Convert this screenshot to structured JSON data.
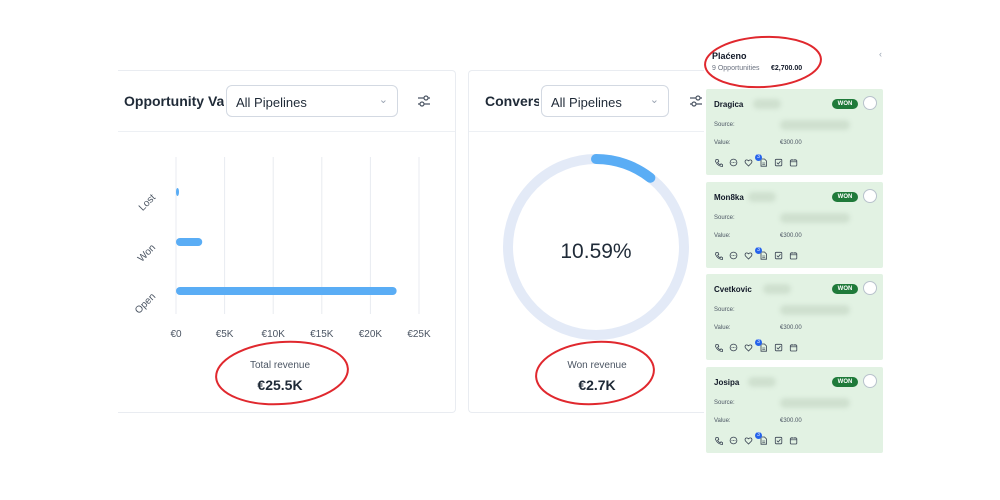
{
  "opportunity_panel": {
    "title": "Opportunity Va",
    "pipeline_select": "All Pipelines",
    "total_revenue_label": "Total revenue",
    "total_revenue_value": "€25.5K"
  },
  "chart_data": {
    "type": "bar",
    "orientation": "horizontal",
    "categories": [
      "Lost",
      "Won",
      "Open"
    ],
    "values": [
      80,
      2700,
      22700
    ],
    "x_tick_labels": [
      "€0",
      "€5K",
      "€10K",
      "€15K",
      "€20K",
      "€25K"
    ],
    "xlim": [
      0,
      25000
    ],
    "grid": true,
    "bar_color": "#5aadf5"
  },
  "conversion_panel": {
    "title": "Convers",
    "pipeline_select": "All Pipelines",
    "conversion_rate": "10.59%",
    "conversion_fraction": 0.1059,
    "won_revenue_label": "Won revenue",
    "won_revenue_value": "€2.7K",
    "ring_track_color": "#e3eaf7",
    "ring_fill_color": "#5aadf5"
  },
  "kanban_column": {
    "name": "Plaćeno",
    "count": "9 Opportunities",
    "amount": "€2,700.00",
    "collapse": "‹",
    "cards": [
      {
        "name": "Dragica",
        "status": "WON",
        "source_label": "Source:",
        "value_label": "Value:",
        "value": "€300.00",
        "badge": "3"
      },
      {
        "name": "Mon8ka",
        "status": "WON",
        "source_label": "Source:",
        "value_label": "Value:",
        "value": "€300.00",
        "badge": "3"
      },
      {
        "name": "Cvetkovic",
        "status": "WON",
        "source_label": "Source:",
        "value_label": "Value:",
        "value": "€300.00",
        "badge": "3"
      },
      {
        "name": "Josipa",
        "status": "WON",
        "source_label": "Source:",
        "value_label": "Value:",
        "value": "€300.00",
        "badge": "3"
      }
    ]
  },
  "annotation_color": "#e0282e"
}
